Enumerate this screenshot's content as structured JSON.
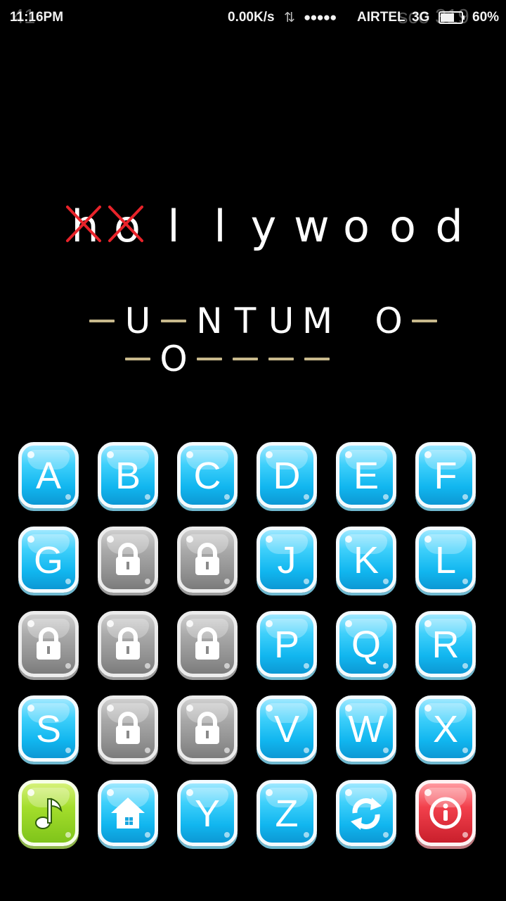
{
  "status_bar": {
    "time": "11:16PM",
    "speed": "0.00K/s",
    "signal_dots": "●●●●●",
    "carrier": "AIRTEL",
    "network": "3G",
    "battery": "60%",
    "ghost_left": "41",
    "ghost_right": "sco 319"
  },
  "used_word": {
    "letters": [
      "h",
      "o",
      "l",
      "l",
      "y",
      "w",
      "o",
      "o",
      "d"
    ],
    "crossed_indices": [
      0,
      1
    ],
    "cross_color": "#e8232a"
  },
  "puzzle": {
    "line1": [
      "",
      "U",
      "",
      "N",
      "T",
      "U",
      "M",
      " ",
      "O",
      ""
    ],
    "line2": [
      "",
      "O",
      "",
      "",
      "",
      ""
    ],
    "dash_color": "#c8b98c"
  },
  "keyboard": {
    "rows": [
      [
        {
          "label": "A",
          "state": "available"
        },
        {
          "label": "B",
          "state": "available"
        },
        {
          "label": "C",
          "state": "available"
        },
        {
          "label": "D",
          "state": "available"
        },
        {
          "label": "E",
          "state": "available"
        },
        {
          "label": "F",
          "state": "available"
        }
      ],
      [
        {
          "label": "G",
          "state": "available"
        },
        {
          "label": "",
          "state": "locked",
          "icon": "lock-icon"
        },
        {
          "label": "",
          "state": "locked",
          "icon": "lock-icon"
        },
        {
          "label": "J",
          "state": "available"
        },
        {
          "label": "K",
          "state": "available"
        },
        {
          "label": "L",
          "state": "available"
        }
      ],
      [
        {
          "label": "",
          "state": "locked",
          "icon": "lock-icon"
        },
        {
          "label": "",
          "state": "locked",
          "icon": "lock-icon"
        },
        {
          "label": "",
          "state": "locked",
          "icon": "lock-icon"
        },
        {
          "label": "P",
          "state": "available"
        },
        {
          "label": "Q",
          "state": "available"
        },
        {
          "label": "R",
          "state": "available"
        }
      ],
      [
        {
          "label": "S",
          "state": "available"
        },
        {
          "label": "",
          "state": "locked",
          "icon": "lock-icon"
        },
        {
          "label": "",
          "state": "locked",
          "icon": "lock-icon"
        },
        {
          "label": "V",
          "state": "available"
        },
        {
          "label": "W",
          "state": "available"
        },
        {
          "label": "X",
          "state": "available"
        }
      ],
      [
        {
          "label": "",
          "state": "music",
          "icon": "music-note-icon"
        },
        {
          "label": "",
          "state": "home",
          "icon": "home-icon"
        },
        {
          "label": "Y",
          "state": "available"
        },
        {
          "label": "Z",
          "state": "available"
        },
        {
          "label": "",
          "state": "restart",
          "icon": "refresh-icon"
        },
        {
          "label": "",
          "state": "info",
          "icon": "info-icon"
        }
      ]
    ],
    "colors": {
      "available": "#1cc0f3",
      "locked": "#9a9a9a",
      "music": "#9bd82a",
      "info": "#e8323e"
    }
  }
}
